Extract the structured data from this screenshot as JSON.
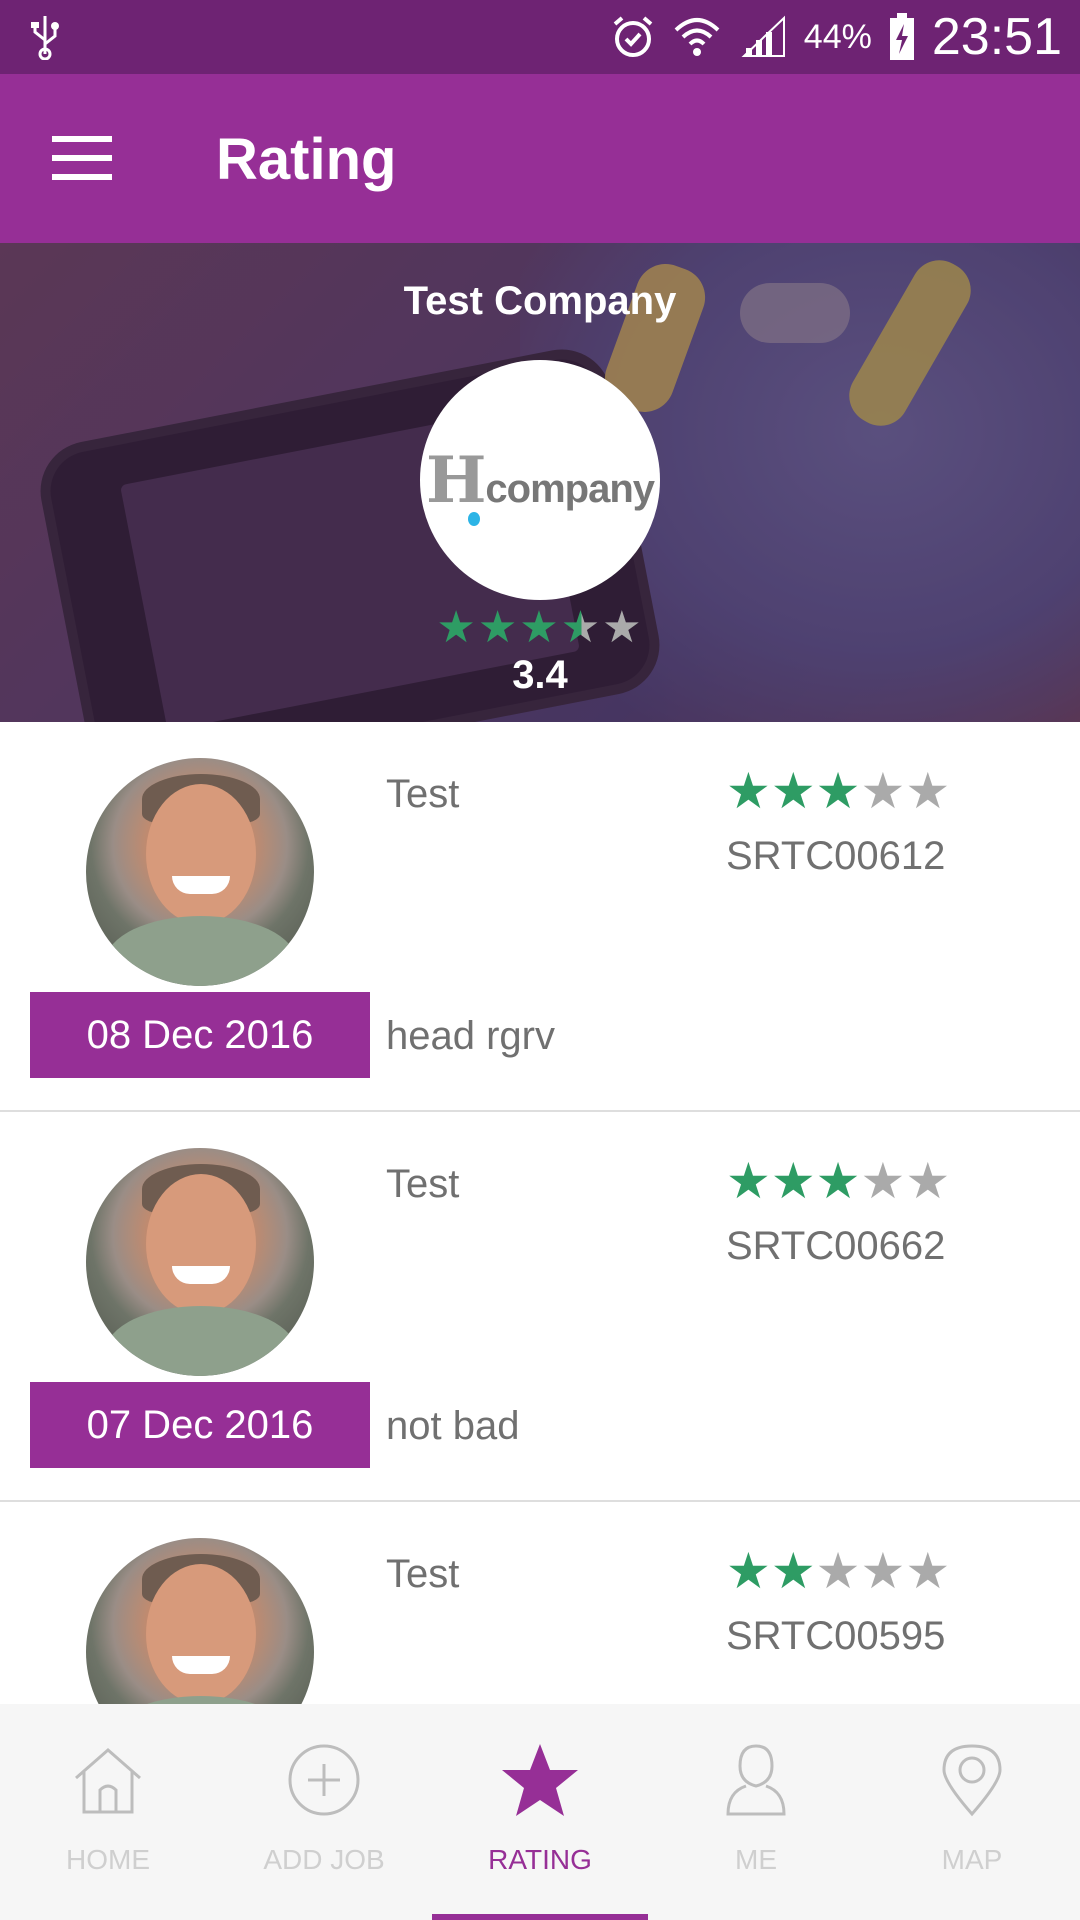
{
  "status_bar": {
    "battery": "44%",
    "time": "23:51"
  },
  "appbar": {
    "title": "Rating"
  },
  "company": {
    "name": "Test Company",
    "logo_text": "company",
    "logo_letter": "H",
    "stars": 3.4,
    "rating": "3.4"
  },
  "reviews": [
    {
      "name": "Test",
      "stars": 3,
      "code": "SRTC00612",
      "date": "08 Dec 2016",
      "comment": "head rgrv"
    },
    {
      "name": "Test",
      "stars": 3,
      "code": "SRTC00662",
      "date": "07 Dec 2016",
      "comment": "not bad"
    },
    {
      "name": "Test",
      "stars": 2,
      "code": "SRTC00595",
      "date": "",
      "comment": ""
    }
  ],
  "bottom_nav": {
    "items": [
      {
        "label": "HOME",
        "icon": "home-icon"
      },
      {
        "label": "ADD JOB",
        "icon": "add-circle-icon"
      },
      {
        "label": "RATING",
        "icon": "star-icon",
        "active": true
      },
      {
        "label": "ME",
        "icon": "person-icon"
      },
      {
        "label": "MAP",
        "icon": "map-pin-icon"
      }
    ]
  },
  "colors": {
    "primary": "#962f96",
    "status_bar": "#6e2373",
    "star": "#2e9c64",
    "star_off": "#aaaaaa"
  }
}
